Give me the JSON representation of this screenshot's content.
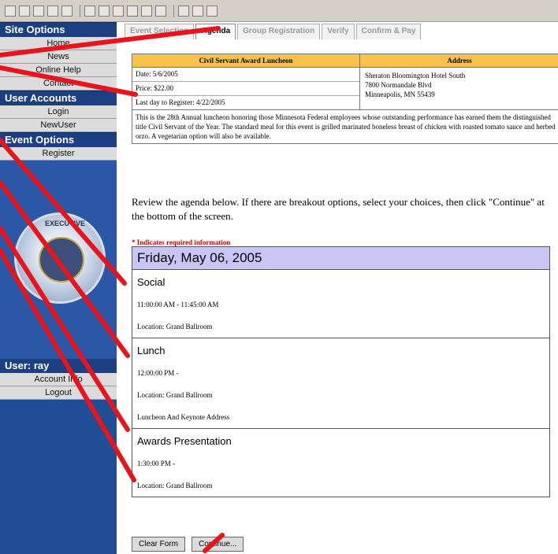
{
  "tabs": [
    "Event Selection",
    "Agenda",
    "Group Registration",
    "Verify",
    "Confirm & Pay"
  ],
  "sidebar": {
    "site_options": "Site Options",
    "site_items": [
      "Home",
      "News",
      "Online Help",
      "Contact"
    ],
    "user_accounts": "User Accounts",
    "user_items": [
      "Login",
      "NewUser"
    ],
    "event_options": "Event Options",
    "event_items": [
      "Register"
    ],
    "seal_text": "EXECUTIVE",
    "user_label": "User: ray",
    "account_items": [
      "Account Info",
      "Logout"
    ]
  },
  "info": {
    "event_name": "Civil Servant Award Luncheon",
    "address_header": "Address",
    "date": "Date: 5/6/2005",
    "price": "Price: $22.00",
    "last_day": "Last day to Register: 4/22/2005",
    "address_lines": [
      "Sheraton Bloomington Hotel South",
      "7800 Normandale Blvd",
      "Minneapolis, MN 55439"
    ],
    "description": "This is the 28th Annual luncheon honoring those Minnesota Federal employees whose outstanding performance has earned them the distinguished title Civil Servant of the Year. The standard meal for this event is grilled marinated boneless breast of chicken with roasted tomato sauce and herbed orzo. A vegetarian option will also be available."
  },
  "review_text": "Review the agenda below. If there are breakout options, select your choices, then click \"Continue\" at the bottom of the screen.",
  "required_note": "* Indicates required information",
  "agenda": {
    "day": "Friday, May 06, 2005",
    "sessions": [
      {
        "title": "Social",
        "lines": [
          "11:00:00 AM - 11:45:00 AM",
          "Location: Grand Ballroom"
        ]
      },
      {
        "title": "Lunch",
        "lines": [
          "12:00:00 PM -",
          "Location: Grand Ballroom",
          "Luncheon And Keynote Address"
        ]
      },
      {
        "title": "Awards Presentation",
        "lines": [
          "1:30:00 PM -",
          "Location: Grand Ballroom"
        ]
      }
    ]
  },
  "buttons": {
    "clear": "Clear Form",
    "continue": "Continue..."
  }
}
